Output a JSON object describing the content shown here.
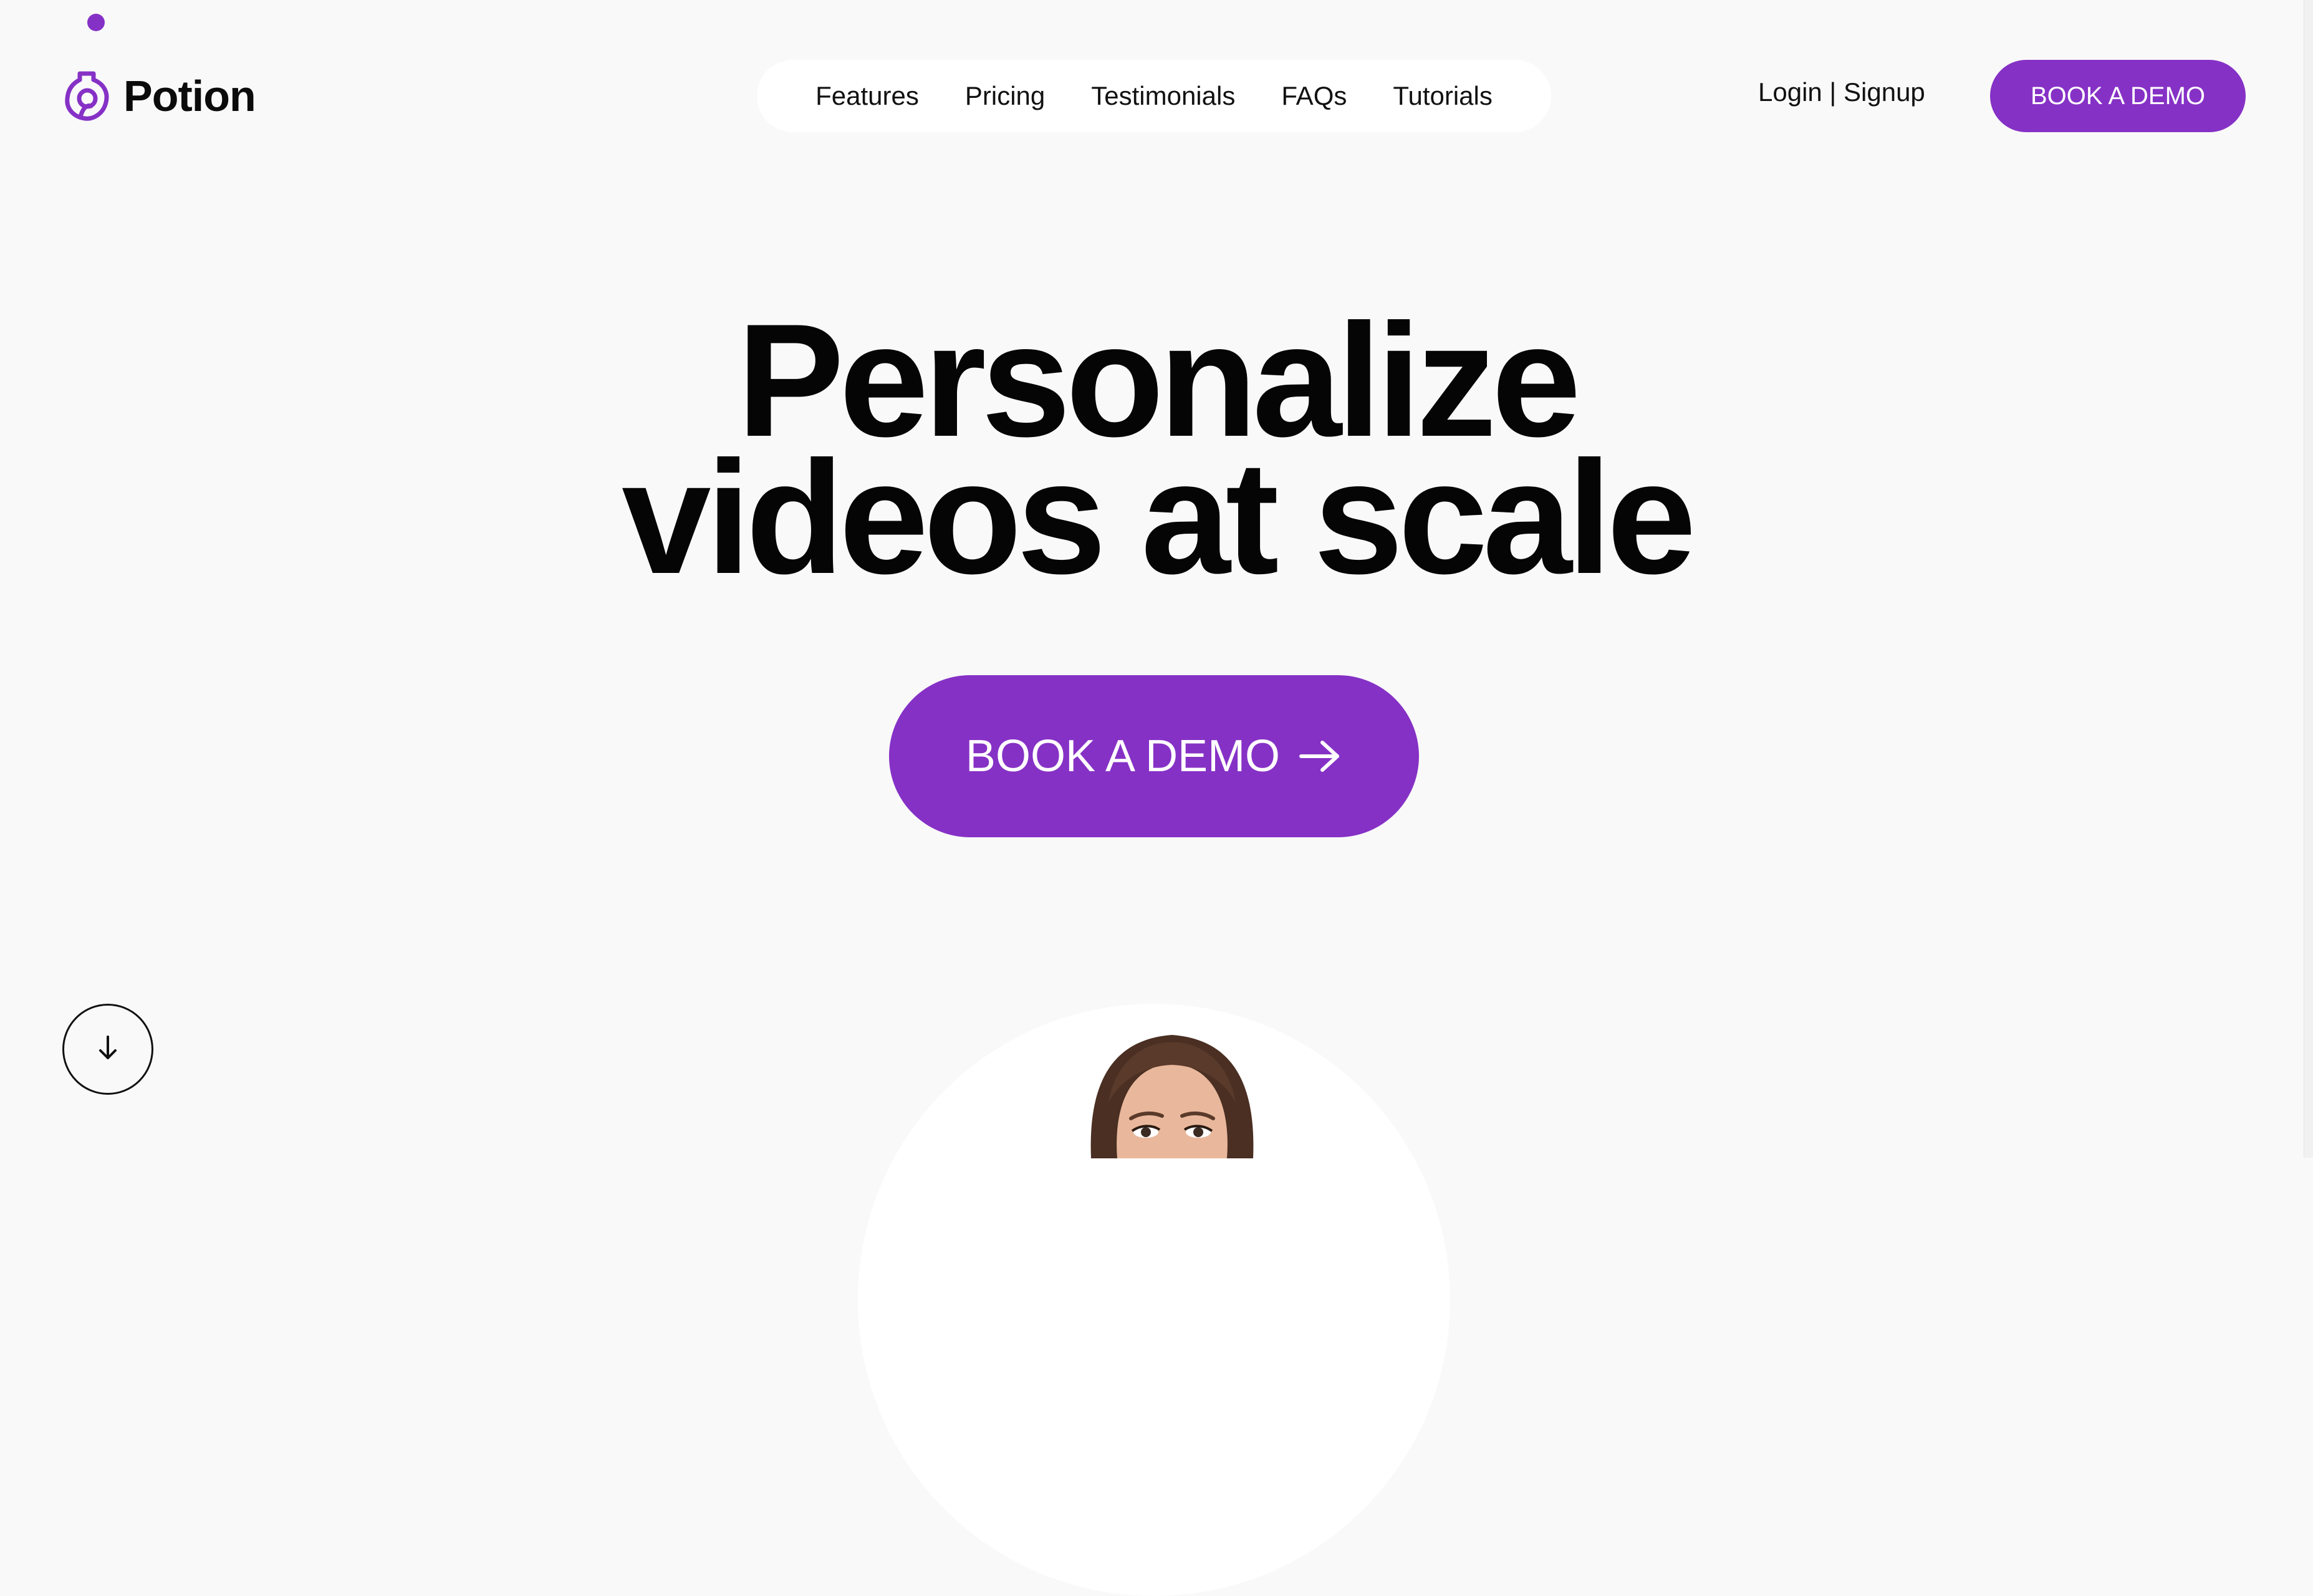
{
  "brand": {
    "name": "Potion",
    "accent_color": "#8631c6",
    "logo_icon": "potion-bottle-icon"
  },
  "nav": {
    "items": [
      {
        "label": "Features"
      },
      {
        "label": "Pricing"
      },
      {
        "label": "Testimonials"
      },
      {
        "label": "FAQs"
      },
      {
        "label": "Tutorials"
      }
    ]
  },
  "header": {
    "auth_label": "Login | Signup",
    "cta_label": "BOOK A DEMO"
  },
  "hero": {
    "title_line1": "Personalize",
    "title_line2": "videos at scale",
    "cta_label": "BOOK A DEMO",
    "cta_icon": "arrow-right-icon"
  },
  "scroll": {
    "icon": "arrow-down-icon"
  },
  "video": {
    "preview_subject": "presenter-photo"
  }
}
